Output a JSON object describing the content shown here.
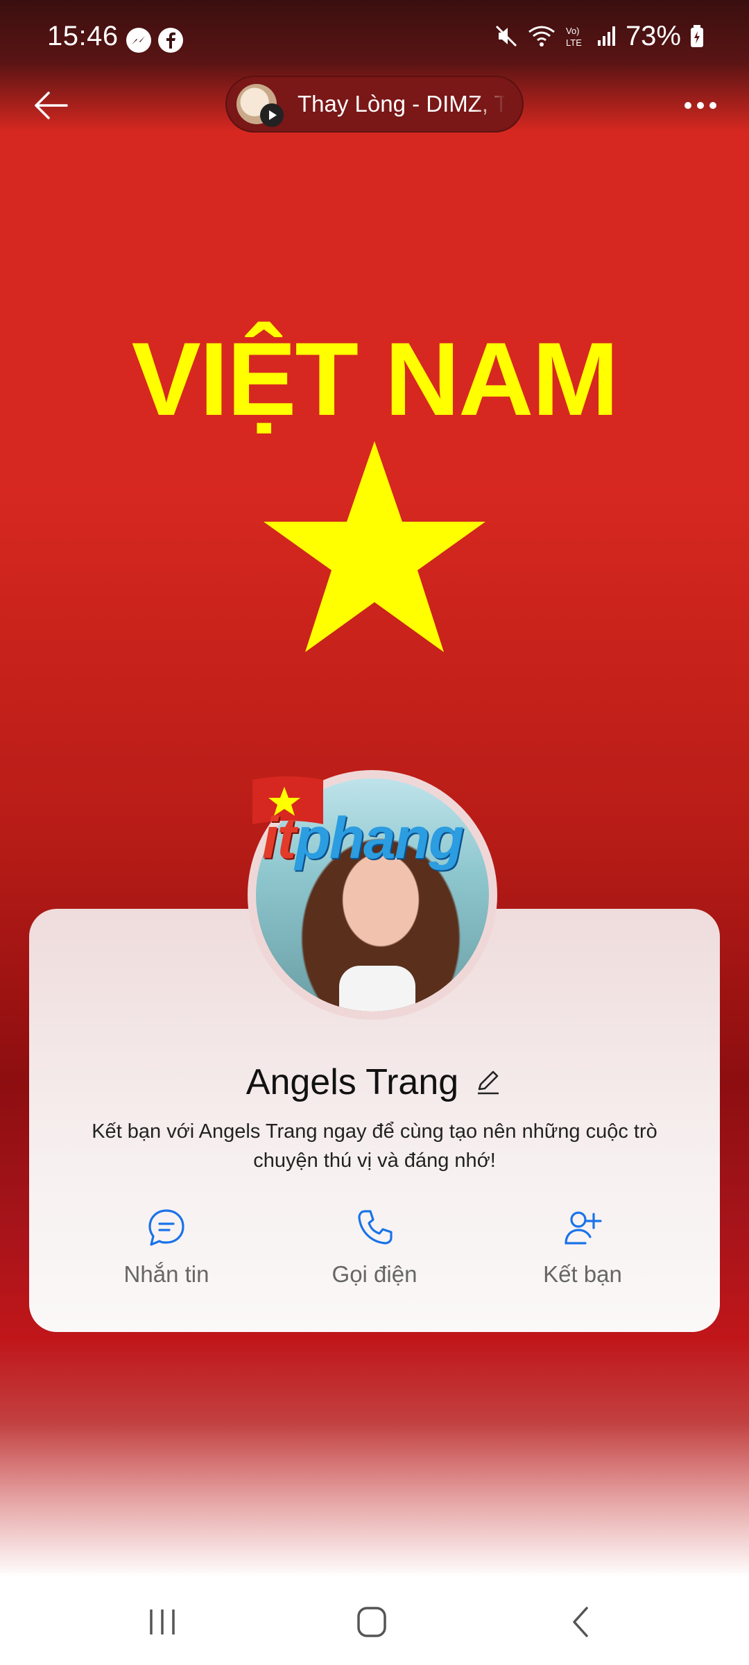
{
  "status_bar": {
    "time": "15:46",
    "battery_percent": "73%",
    "icons": [
      "messenger-icon",
      "facebook-icon",
      "mute-icon",
      "wifi-icon",
      "volte-icon",
      "signal-icon",
      "battery-icon"
    ]
  },
  "top_bar": {
    "music_title": "Thay Lòng - DIMZ, TVk",
    "back_icon": "arrow-left-icon",
    "more_icon": "more-horizontal-icon"
  },
  "cover": {
    "text": "VIỆT NAM",
    "colors": {
      "background": "#d62820",
      "star": "#ffff00"
    }
  },
  "avatar": {
    "watermark_prefix": "it",
    "watermark_rest": "phang"
  },
  "profile": {
    "name": "Angels Trang",
    "description": "Kết bạn với Angels Trang ngay để cùng tạo nên những cuộc trò chuyện thú vị và đáng nhớ!",
    "actions": [
      {
        "label": "Nhắn tin",
        "icon": "message-icon"
      },
      {
        "label": "Gọi điện",
        "icon": "phone-icon"
      },
      {
        "label": "Kết bạn",
        "icon": "add-friend-icon"
      }
    ],
    "accent_color": "#1a73e8"
  },
  "nav_bar": {
    "icons": [
      "recents-icon",
      "home-icon",
      "back-icon"
    ]
  }
}
